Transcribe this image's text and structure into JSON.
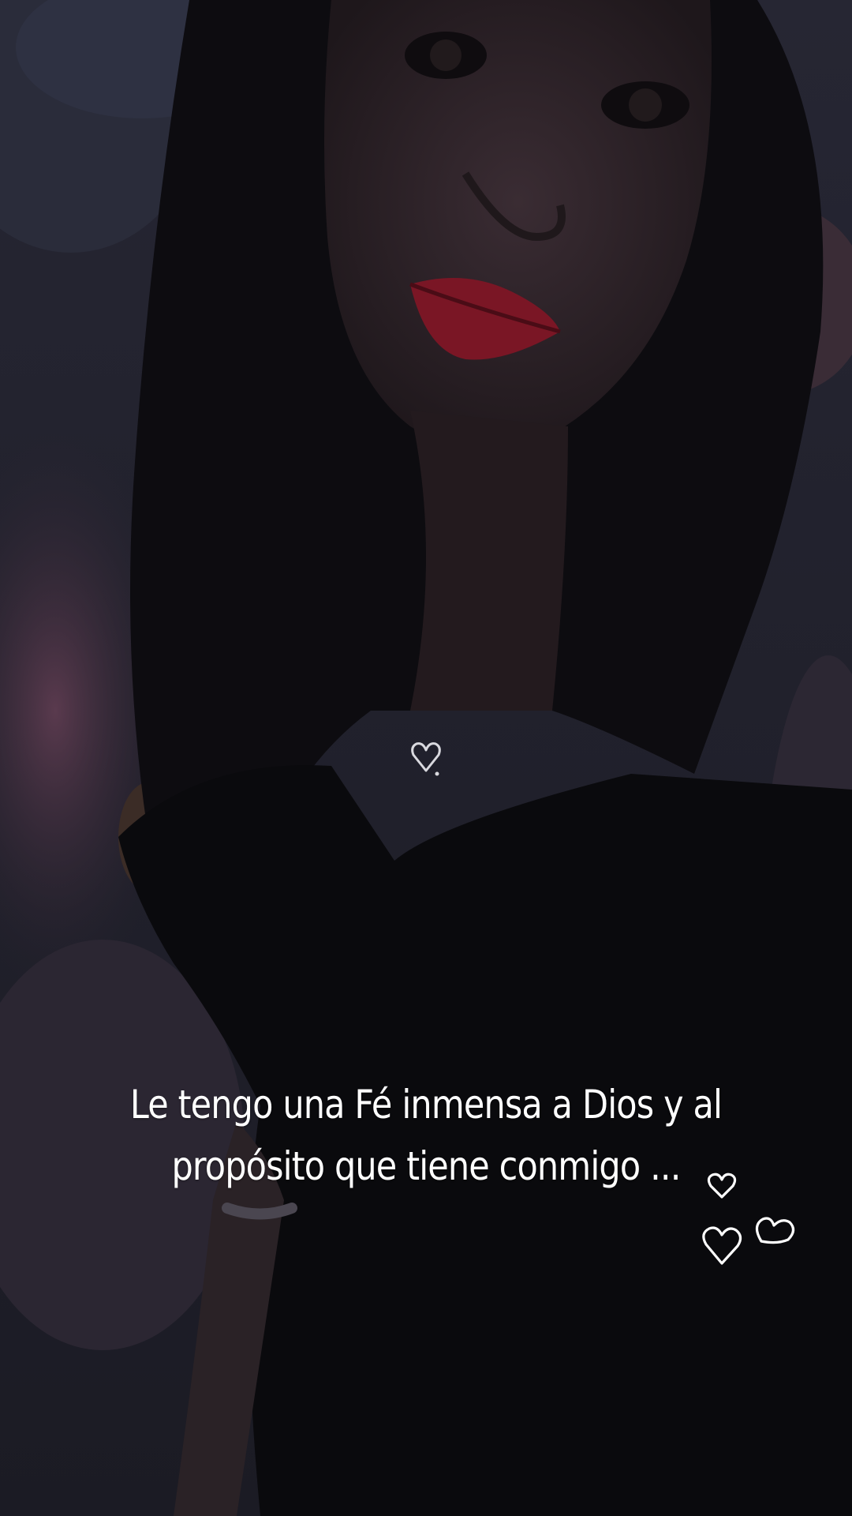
{
  "story": {
    "caption_lines": [
      "Le tengo una Fé inmensa a Dios y al",
      "propósito que tiene conmigo ..."
    ]
  },
  "icons": {
    "sticker": "three-hearts-outline-icon",
    "pendant": "heart-pendant-icon"
  },
  "colors": {
    "background": "#121215",
    "text": "#ffffff",
    "lip": "#9a1a2a"
  }
}
